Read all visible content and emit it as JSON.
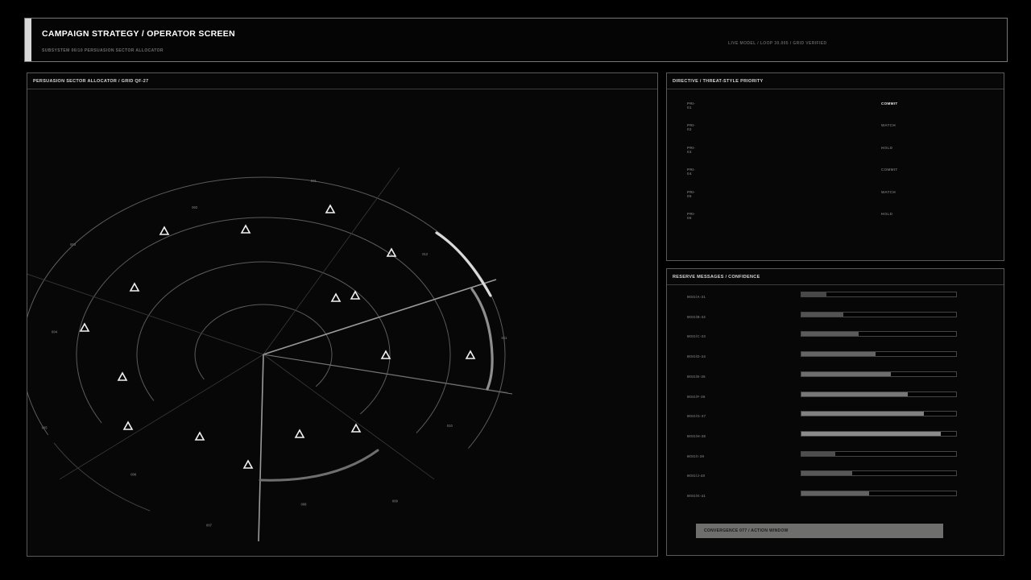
{
  "header": {
    "title": "CAMPAIGN STRATEGY / OPERATOR SCREEN",
    "subtitle": "SUBSYSTEM 06/10  PERSUASION SECTOR ALLOCATOR",
    "status": "LIVE MODEL / LOOP 30.005 / GRID VERIFIED"
  },
  "radar": {
    "title": "PERSUASION SECTOR ALLOCATOR / GRID QF-27",
    "sector_labels": [
      "001",
      "002",
      "003",
      "004",
      "005",
      "006",
      "007",
      "008",
      "009",
      "010",
      "011",
      "012"
    ],
    "marker_icon": "triangle-marker-icon",
    "marker_count": 16
  },
  "directive": {
    "title": "DIRECTIVE / THREAT-STYLE PRIORITY",
    "rows": [
      {
        "id": "PRI-01",
        "state": "COMMIT",
        "active": true
      },
      {
        "id": "PRI-02",
        "state": "WATCH",
        "active": false
      },
      {
        "id": "PRI-03",
        "state": "HOLD",
        "active": false
      },
      {
        "id": "PRI-04",
        "state": "COMMIT",
        "active": false
      },
      {
        "id": "PRI-05",
        "state": "WATCH",
        "active": false
      },
      {
        "id": "PRI-06",
        "state": "HOLD",
        "active": false
      }
    ]
  },
  "reserve": {
    "title": "RESERVE MESSAGES / CONFIDENCE",
    "messages": [
      {
        "label": "MSG/A-31",
        "confidence": 0.16
      },
      {
        "label": "MSG/B-32",
        "confidence": 0.27
      },
      {
        "label": "MSG/C-33",
        "confidence": 0.37
      },
      {
        "label": "MSG/D-34",
        "confidence": 0.48
      },
      {
        "label": "MSG/E-35",
        "confidence": 0.58
      },
      {
        "label": "MSG/F-36",
        "confidence": 0.69
      },
      {
        "label": "MSG/G-37",
        "confidence": 0.79
      },
      {
        "label": "MSG/H-38",
        "confidence": 0.9
      },
      {
        "label": "MSG/I-39",
        "confidence": 0.22
      },
      {
        "label": "MSG/J-40",
        "confidence": 0.33
      },
      {
        "label": "MSG/K-41",
        "confidence": 0.44
      }
    ],
    "convergence_label": "CONVERGENCE 077 / ACTION WINDOW"
  },
  "colors": {
    "background": "#000000",
    "panel": "#060706",
    "border": "#5a5a5a",
    "highlight_arc": "#d9d9d9",
    "mid_arc": "#8e8e8e",
    "low_arc": "#6f6f6f",
    "convergence_bar": "#6e6f6d"
  }
}
